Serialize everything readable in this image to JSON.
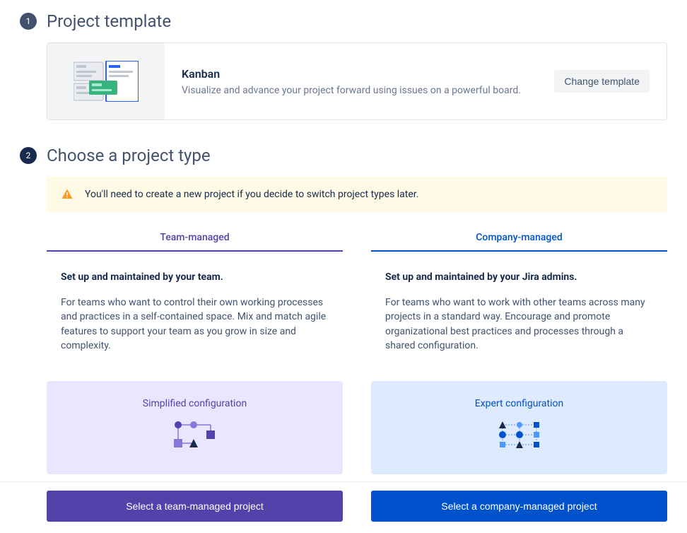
{
  "steps": {
    "template": {
      "number": "1",
      "title": "Project template"
    },
    "type": {
      "number": "2",
      "title": "Choose a project type"
    }
  },
  "template_card": {
    "name": "Kanban",
    "description": "Visualize and advance your project forward using issues on a powerful board.",
    "change_label": "Change template"
  },
  "warning": {
    "message": "You'll need to create a new project if you decide to switch project types later."
  },
  "team": {
    "tab": "Team-managed",
    "heading": "Set up and maintained by your team.",
    "body": "For teams who want to control their own working processes and practices in a self-contained space. Mix and match agile features to support your team as you grow in size and complexity.",
    "config_title": "Simplified configuration",
    "cta": "Select a team-managed project"
  },
  "company": {
    "tab": "Company-managed",
    "heading": "Set up and maintained by your Jira admins.",
    "body": "For teams who want to work with other teams across many projects in a standard way. Encourage and promote organizational best practices and processes through a shared configuration.",
    "config_title": "Expert configuration",
    "cta": "Select a company-managed project"
  }
}
